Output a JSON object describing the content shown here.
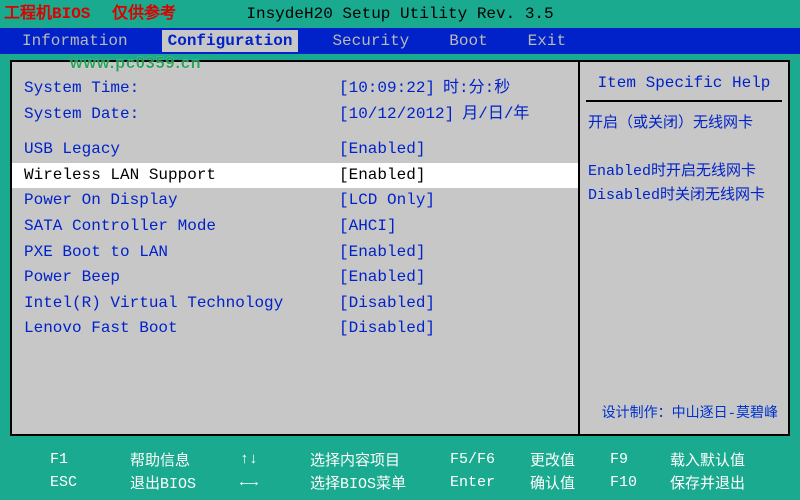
{
  "top": {
    "warn1": "工程机BIOS",
    "warn2": "仅供参考",
    "title": "InsydeH20 Setup Utility Rev. 3.5"
  },
  "tabs": [
    "Information",
    "Configuration",
    "Security",
    "Boot",
    "Exit"
  ],
  "active_tab": 1,
  "watermark": "www.pc0359.cn",
  "rows": [
    {
      "label": "System Time:",
      "value": "[10:09:22]",
      "aux": "时:分:秒"
    },
    {
      "label": "System Date:",
      "value": "[10/12/2012]",
      "aux": "月/日/年"
    },
    {
      "spacer": true
    },
    {
      "label": "USB Legacy",
      "value": "[Enabled]"
    },
    {
      "label": "Wireless LAN Support",
      "value": "[Enabled]",
      "selected": true
    },
    {
      "label": "Power On Display",
      "value": "[LCD Only]"
    },
    {
      "label": "SATA Controller Mode",
      "value": "[AHCI]"
    },
    {
      "label": "PXE Boot to LAN",
      "value": "[Enabled]"
    },
    {
      "label": "Power Beep",
      "value": "[Enabled]"
    },
    {
      "label": "Intel(R) Virtual Technology",
      "value": "[Disabled]"
    },
    {
      "label": "Lenovo Fast Boot",
      "value": "[Disabled]"
    }
  ],
  "help": {
    "title": "Item Specific Help",
    "body": "开启（或关闭）无线网卡\n\nEnabled时开启无线网卡\nDisabled时关闭无线网卡"
  },
  "credit": "设计制作：中山逐日-莫碧峰",
  "footer": {
    "r1": [
      "F1",
      "帮助信息",
      "↑↓",
      "选择内容项目",
      "F5/F6",
      "更改值",
      "F9",
      "载入默认值"
    ],
    "r2": [
      "ESC",
      "退出BIOS",
      "←→",
      "选择BIOS菜单",
      "Enter",
      "确认值",
      "F10",
      "保存并退出"
    ]
  }
}
